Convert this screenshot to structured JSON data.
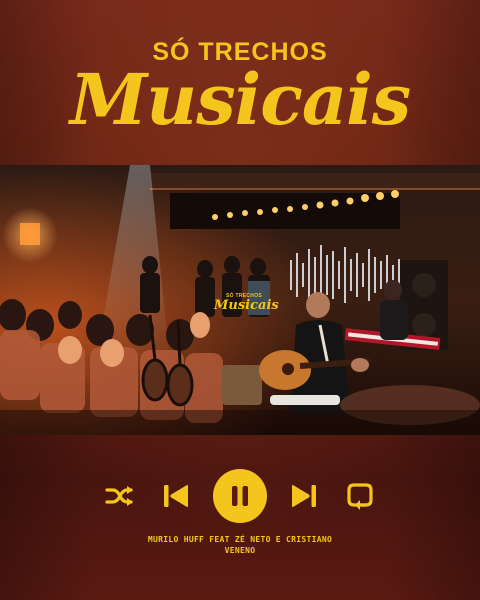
{
  "brand": {
    "top": "SÓ TRECHOS",
    "main": "Musicais"
  },
  "video": {
    "overlay_top": "SÓ TRECHOS",
    "overlay_main": "Musicais"
  },
  "controls": {
    "shuffle": "shuffle-icon",
    "previous": "skip-back-icon",
    "pause": "pause-icon",
    "next": "skip-forward-icon",
    "repeat": "repeat-icon",
    "accent": "#f4c51c"
  },
  "song": {
    "line1": "MURILO HUFF FEAT ZÉ NETO E CRISTIANO",
    "line2": "VENENO"
  }
}
